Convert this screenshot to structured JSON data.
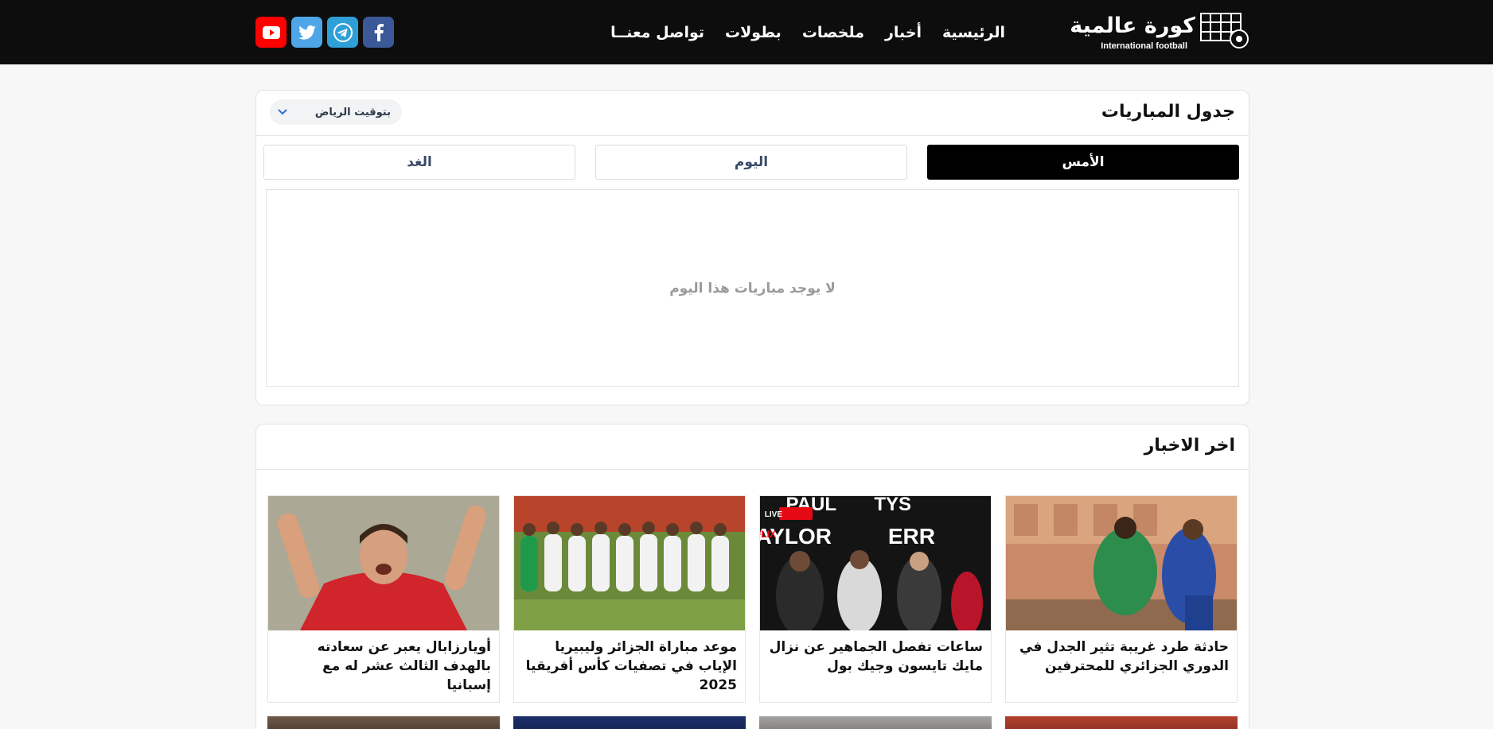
{
  "header": {
    "logo_ar": "كورة عالمية",
    "logo_en": "International football",
    "nav": [
      "الرئيسية",
      "أخبار",
      "ملخصات",
      "بطولات",
      "تواصل معنــا"
    ],
    "social": [
      "facebook-icon",
      "telegram-icon",
      "twitter-icon",
      "youtube-icon"
    ]
  },
  "schedule": {
    "title": "جدول المباريات",
    "timezone": "بتوقيت الرياض",
    "tabs": [
      "الأمس",
      "اليوم",
      "الغد"
    ],
    "active_tab": "الأمس",
    "empty_message": "لا يوجد مباريات هذا اليوم"
  },
  "news": {
    "title": "اخر الاخبار",
    "items": [
      {
        "headline": "حادثة طرد غريبة تثير الجدل في الدوري الجزائري للمحترفين"
      },
      {
        "headline": "ساعات تفصل الجماهير عن نزال مايك تايسون وجيك بول"
      },
      {
        "headline": "موعد مباراة الجزائر وليبيريا الإياب في تصفيات كأس أفريقيا 2025"
      },
      {
        "headline": "أويارزابال يعبر عن سعادته بالهدف الثالث عشر له مع إسبانيا"
      }
    ]
  },
  "colors": {
    "header_bg": "#0d0d0d",
    "youtube": "#ff0000",
    "twitter": "#4ea6e9",
    "telegram": "#2f9fd8",
    "facebook": "#3b5998"
  }
}
